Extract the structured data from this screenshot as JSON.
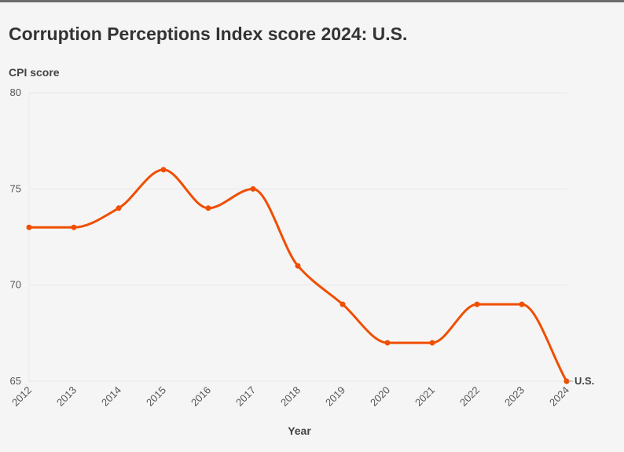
{
  "chart_data": {
    "type": "line",
    "title": "Corruption Perceptions Index score 2024: U.S.",
    "xlabel": "Year",
    "ylabel": "CPI score",
    "x": [
      "2012",
      "2013",
      "2014",
      "2015",
      "2016",
      "2017",
      "2018",
      "2019",
      "2020",
      "2021",
      "2022",
      "2023",
      "2024"
    ],
    "series": [
      {
        "name": "U.S.",
        "color": "#f04e00",
        "values": [
          73,
          73,
          74,
          76,
          74,
          75,
          71,
          69,
          67,
          67,
          69,
          69,
          65
        ]
      }
    ],
    "yticks": [
      "80",
      "75",
      "70",
      "65"
    ],
    "ylim": [
      65,
      80
    ],
    "grid": true,
    "legend": "end-label"
  }
}
